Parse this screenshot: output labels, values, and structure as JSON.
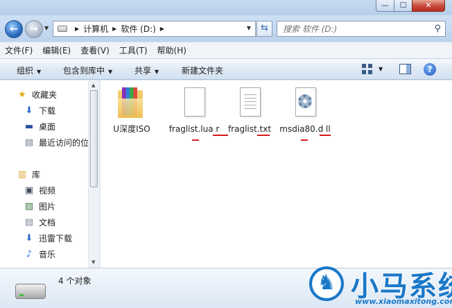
{
  "window": {
    "minimize": "—",
    "maximize": "☐",
    "close": "✕"
  },
  "address": {
    "crumbs": [
      "计算机",
      "软件 (D:)"
    ],
    "search_placeholder": "搜索 软件 (D:)"
  },
  "menu": [
    "文件(F)",
    "编辑(E)",
    "查看(V)",
    "工具(T)",
    "帮助(H)"
  ],
  "toolbar": {
    "organize": "组织",
    "include_in_library": "包含到库中",
    "share": "共享",
    "new_folder": "新建文件夹"
  },
  "nav": {
    "favorites": {
      "label": "收藏夹",
      "items": [
        "下载",
        "桌面",
        "最近访问的位置"
      ]
    },
    "libraries": {
      "label": "库",
      "items": [
        "视频",
        "图片",
        "文档",
        "迅雷下载",
        "音乐"
      ]
    }
  },
  "files": [
    {
      "name": "U深度ISO",
      "type": "archive-folder"
    },
    {
      "name": "fraglist.lua r",
      "type": "blank-file"
    },
    {
      "name": "fraglist.txt",
      "type": "text-file"
    },
    {
      "name": "msdia80.d ll",
      "type": "dll-file"
    }
  ],
  "details": {
    "count": "4 个对象"
  },
  "watermark": {
    "brand": "小马系统",
    "url": "www.xiaomaxitong.com"
  },
  "colors": {
    "accent": "#1a78c8",
    "underline": "#d61a1a"
  }
}
